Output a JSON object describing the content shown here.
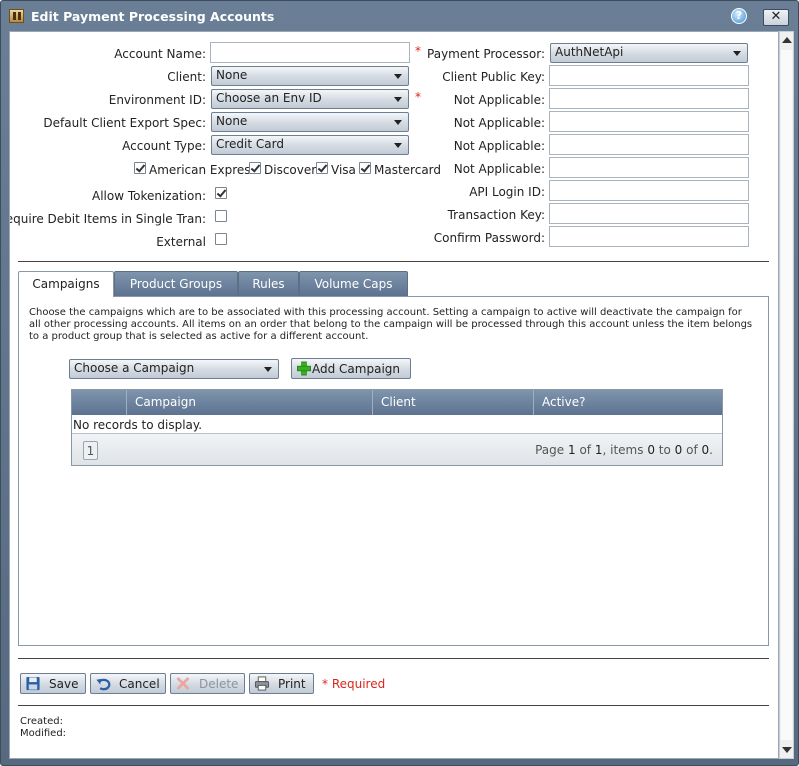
{
  "window": {
    "title": "Edit Payment Processing Accounts",
    "help_label": "?",
    "close_label": "✕"
  },
  "form_left": {
    "account_name": {
      "label": "Account Name:",
      "value": "",
      "required": "*"
    },
    "client": {
      "label": "Client:",
      "value": "None"
    },
    "environment_id": {
      "label": "Environment ID:",
      "value": "Choose an Env ID",
      "required": "*"
    },
    "default_client_export_spec": {
      "label": "Default Client Export Spec:",
      "value": "None"
    },
    "account_type": {
      "label": "Account Type:",
      "value": "Credit Card"
    },
    "card_types": [
      {
        "label": "American Express",
        "checked": true
      },
      {
        "label": "Discover",
        "checked": true
      },
      {
        "label": "Visa",
        "checked": true
      },
      {
        "label": "Mastercard",
        "checked": true
      }
    ],
    "allow_tokenization": {
      "label": "Allow Tokenization:",
      "checked": true
    },
    "require_debit_items": {
      "label": "Require Debit Items in Single Tran:",
      "checked": false
    },
    "external": {
      "label": "External",
      "checked": false
    }
  },
  "form_right": {
    "payment_processor": {
      "label": "Payment Processor:",
      "value": "AuthNetApi"
    },
    "fields": [
      {
        "label": "Client Public Key:",
        "value": ""
      },
      {
        "label": "Not Applicable:",
        "value": ""
      },
      {
        "label": "Not Applicable:",
        "value": ""
      },
      {
        "label": "Not Applicable:",
        "value": ""
      },
      {
        "label": "Not Applicable:",
        "value": ""
      },
      {
        "label": "API Login ID:",
        "value": ""
      },
      {
        "label": "Transaction Key:",
        "value": ""
      },
      {
        "label": "Confirm Password:",
        "value": ""
      }
    ]
  },
  "tabs": [
    {
      "label": "Campaigns",
      "active": true
    },
    {
      "label": "Product Groups",
      "active": false
    },
    {
      "label": "Rules",
      "active": false
    },
    {
      "label": "Volume Caps",
      "active": false
    }
  ],
  "campaigns": {
    "description": "Choose the campaigns which are to be associated with this processing account. Setting a campaign to active will deactivate the campaign for all other processing accounts. All items on an order that belong to the campaign will be processed through this account unless the item belongs to a product group that is selected as active for a different account.",
    "choose_value": "Choose a Campaign",
    "add_label": "Add Campaign",
    "grid": {
      "columns": [
        "Campaign",
        "Client",
        "Active?"
      ],
      "empty_text": "No records to display.",
      "page_number": "1",
      "pager": {
        "prefix": "Page",
        "page": "1",
        "of": "of",
        "total_pages": "1",
        "items_label": ", items",
        "from": "0",
        "to": "to",
        "to_val": "0",
        "of2": "of",
        "count": "0",
        "suffix": "."
      }
    }
  },
  "footer": {
    "save_label": "Save",
    "cancel_label": "Cancel",
    "delete_label": "Delete",
    "print_label": "Print",
    "required_note": "* Required",
    "created_label": "Created:",
    "modified_label": "Modified:"
  },
  "colors": {
    "title_bar": "#5f7489",
    "tab_header": "#6b819c",
    "required": "#d8261c",
    "add_icon": "#37b21e"
  }
}
